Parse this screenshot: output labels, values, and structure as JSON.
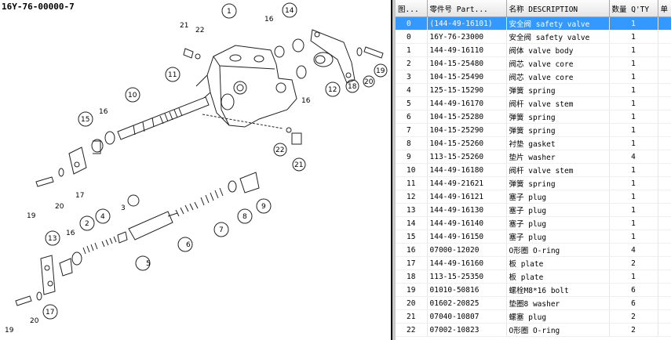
{
  "diagram": {
    "title": "16Y-76-00000-7",
    "callouts": [
      "1",
      "2",
      "3",
      "4",
      "5",
      "6",
      "7",
      "8",
      "9",
      "10",
      "11",
      "12",
      "13",
      "14",
      "15",
      "16",
      "16",
      "16",
      "16",
      "17",
      "17",
      "18",
      "19",
      "19",
      "19",
      "20",
      "20",
      "20",
      "21",
      "21",
      "22",
      "22"
    ]
  },
  "table": {
    "headers": [
      "图...",
      "零件号 Part...",
      "名称 DESCRIPTION",
      "数量 Q'TY",
      "单"
    ],
    "selected_row": 0,
    "rows": [
      {
        "no": "0",
        "part": "(144-49-16101)",
        "desc": "安全阀 safety valve",
        "qty": "1"
      },
      {
        "no": "0",
        "part": "16Y-76-23000",
        "desc": "安全阀 safety valve",
        "qty": "1"
      },
      {
        "no": "1",
        "part": "144-49-16110",
        "desc": "阀体 valve body",
        "qty": "1"
      },
      {
        "no": "2",
        "part": "104-15-25480",
        "desc": "阀芯 valve core",
        "qty": "1"
      },
      {
        "no": "3",
        "part": "104-15-25490",
        "desc": "阀芯 valve core",
        "qty": "1"
      },
      {
        "no": "4",
        "part": "125-15-15290",
        "desc": "弹簧 spring",
        "qty": "1"
      },
      {
        "no": "5",
        "part": "144-49-16170",
        "desc": "阀杆 valve stem",
        "qty": "1"
      },
      {
        "no": "6",
        "part": "104-15-25280",
        "desc": "弹簧 spring",
        "qty": "1"
      },
      {
        "no": "7",
        "part": "104-15-25290",
        "desc": "弹簧 spring",
        "qty": "1"
      },
      {
        "no": "8",
        "part": "104-15-25260",
        "desc": "衬垫 gasket",
        "qty": "1"
      },
      {
        "no": "9",
        "part": "113-15-25260",
        "desc": "垫片 washer",
        "qty": "4"
      },
      {
        "no": "10",
        "part": "144-49-16180",
        "desc": "阀杆 valve stem",
        "qty": "1"
      },
      {
        "no": "11",
        "part": "144-49-21621",
        "desc": "弹簧 spring",
        "qty": "1"
      },
      {
        "no": "12",
        "part": "144-49-16121",
        "desc": "塞子 plug",
        "qty": "1"
      },
      {
        "no": "13",
        "part": "144-49-16130",
        "desc": "塞子 plug",
        "qty": "1"
      },
      {
        "no": "14",
        "part": "144-49-16140",
        "desc": "塞子 plug",
        "qty": "1"
      },
      {
        "no": "15",
        "part": "144-49-16150",
        "desc": "塞子 plug",
        "qty": "1"
      },
      {
        "no": "16",
        "part": "07000-12020",
        "desc": "O形圈 O-ring",
        "qty": "4"
      },
      {
        "no": "17",
        "part": "144-49-16160",
        "desc": "板 plate",
        "qty": "2"
      },
      {
        "no": "18",
        "part": "113-15-25350",
        "desc": "板 plate",
        "qty": "1"
      },
      {
        "no": "19",
        "part": "01010-50816",
        "desc": "螺栓M8*16 bolt",
        "qty": "6"
      },
      {
        "no": "20",
        "part": "01602-20825",
        "desc": "垫圈8 washer",
        "qty": "6"
      },
      {
        "no": "21",
        "part": "07040-10807",
        "desc": "螺塞 plug",
        "qty": "2"
      },
      {
        "no": "22",
        "part": "07002-10823",
        "desc": "O形圈 O-ring",
        "qty": "2"
      }
    ]
  }
}
